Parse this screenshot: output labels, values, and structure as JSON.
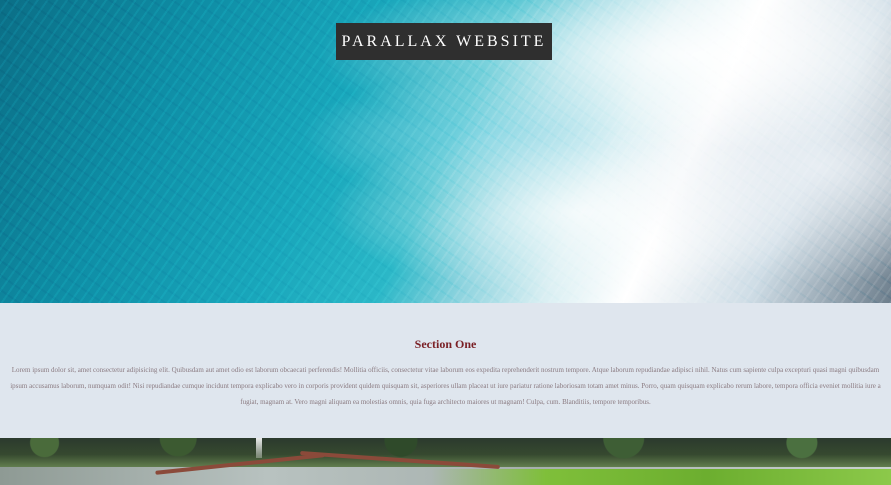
{
  "header": {
    "title": "PARALLAX WEBSITE"
  },
  "section_one": {
    "heading": "Section One",
    "body": "Lorem ipsum dolor sit, amet consectetur adipisicing elit. Quibusdam aut amet odio est laborum obcaecati perferendis! Mollitia officiis, consectetur vitae laborum eos expedita reprehenderit nostrum tempore. Atque laborum repudiandae adipisci nihil. Natus cum sapiente culpa excepturi quasi magni quibusdam ipsum accusamus laborum, numquam odit! Nisi repudiandae cumque incidunt tempora explicabo vero in corporis provident quidem quisquam sit, asperiores ullam placeat ut iure pariatur ratione laboriosam totam amet minus. Porro, quam quisquam explicabo rerum labore, tempora officia eveniet mollitia iure a fugiat, magnam at. Vero magni aliquam ea molestias omnis, quia fuga architecto maiores ut magnam! Culpa, cum. Blanditiis, tempore temporibus."
  },
  "images": {
    "hero": "ocean-waves-image",
    "footer": "forest-stream-image"
  }
}
